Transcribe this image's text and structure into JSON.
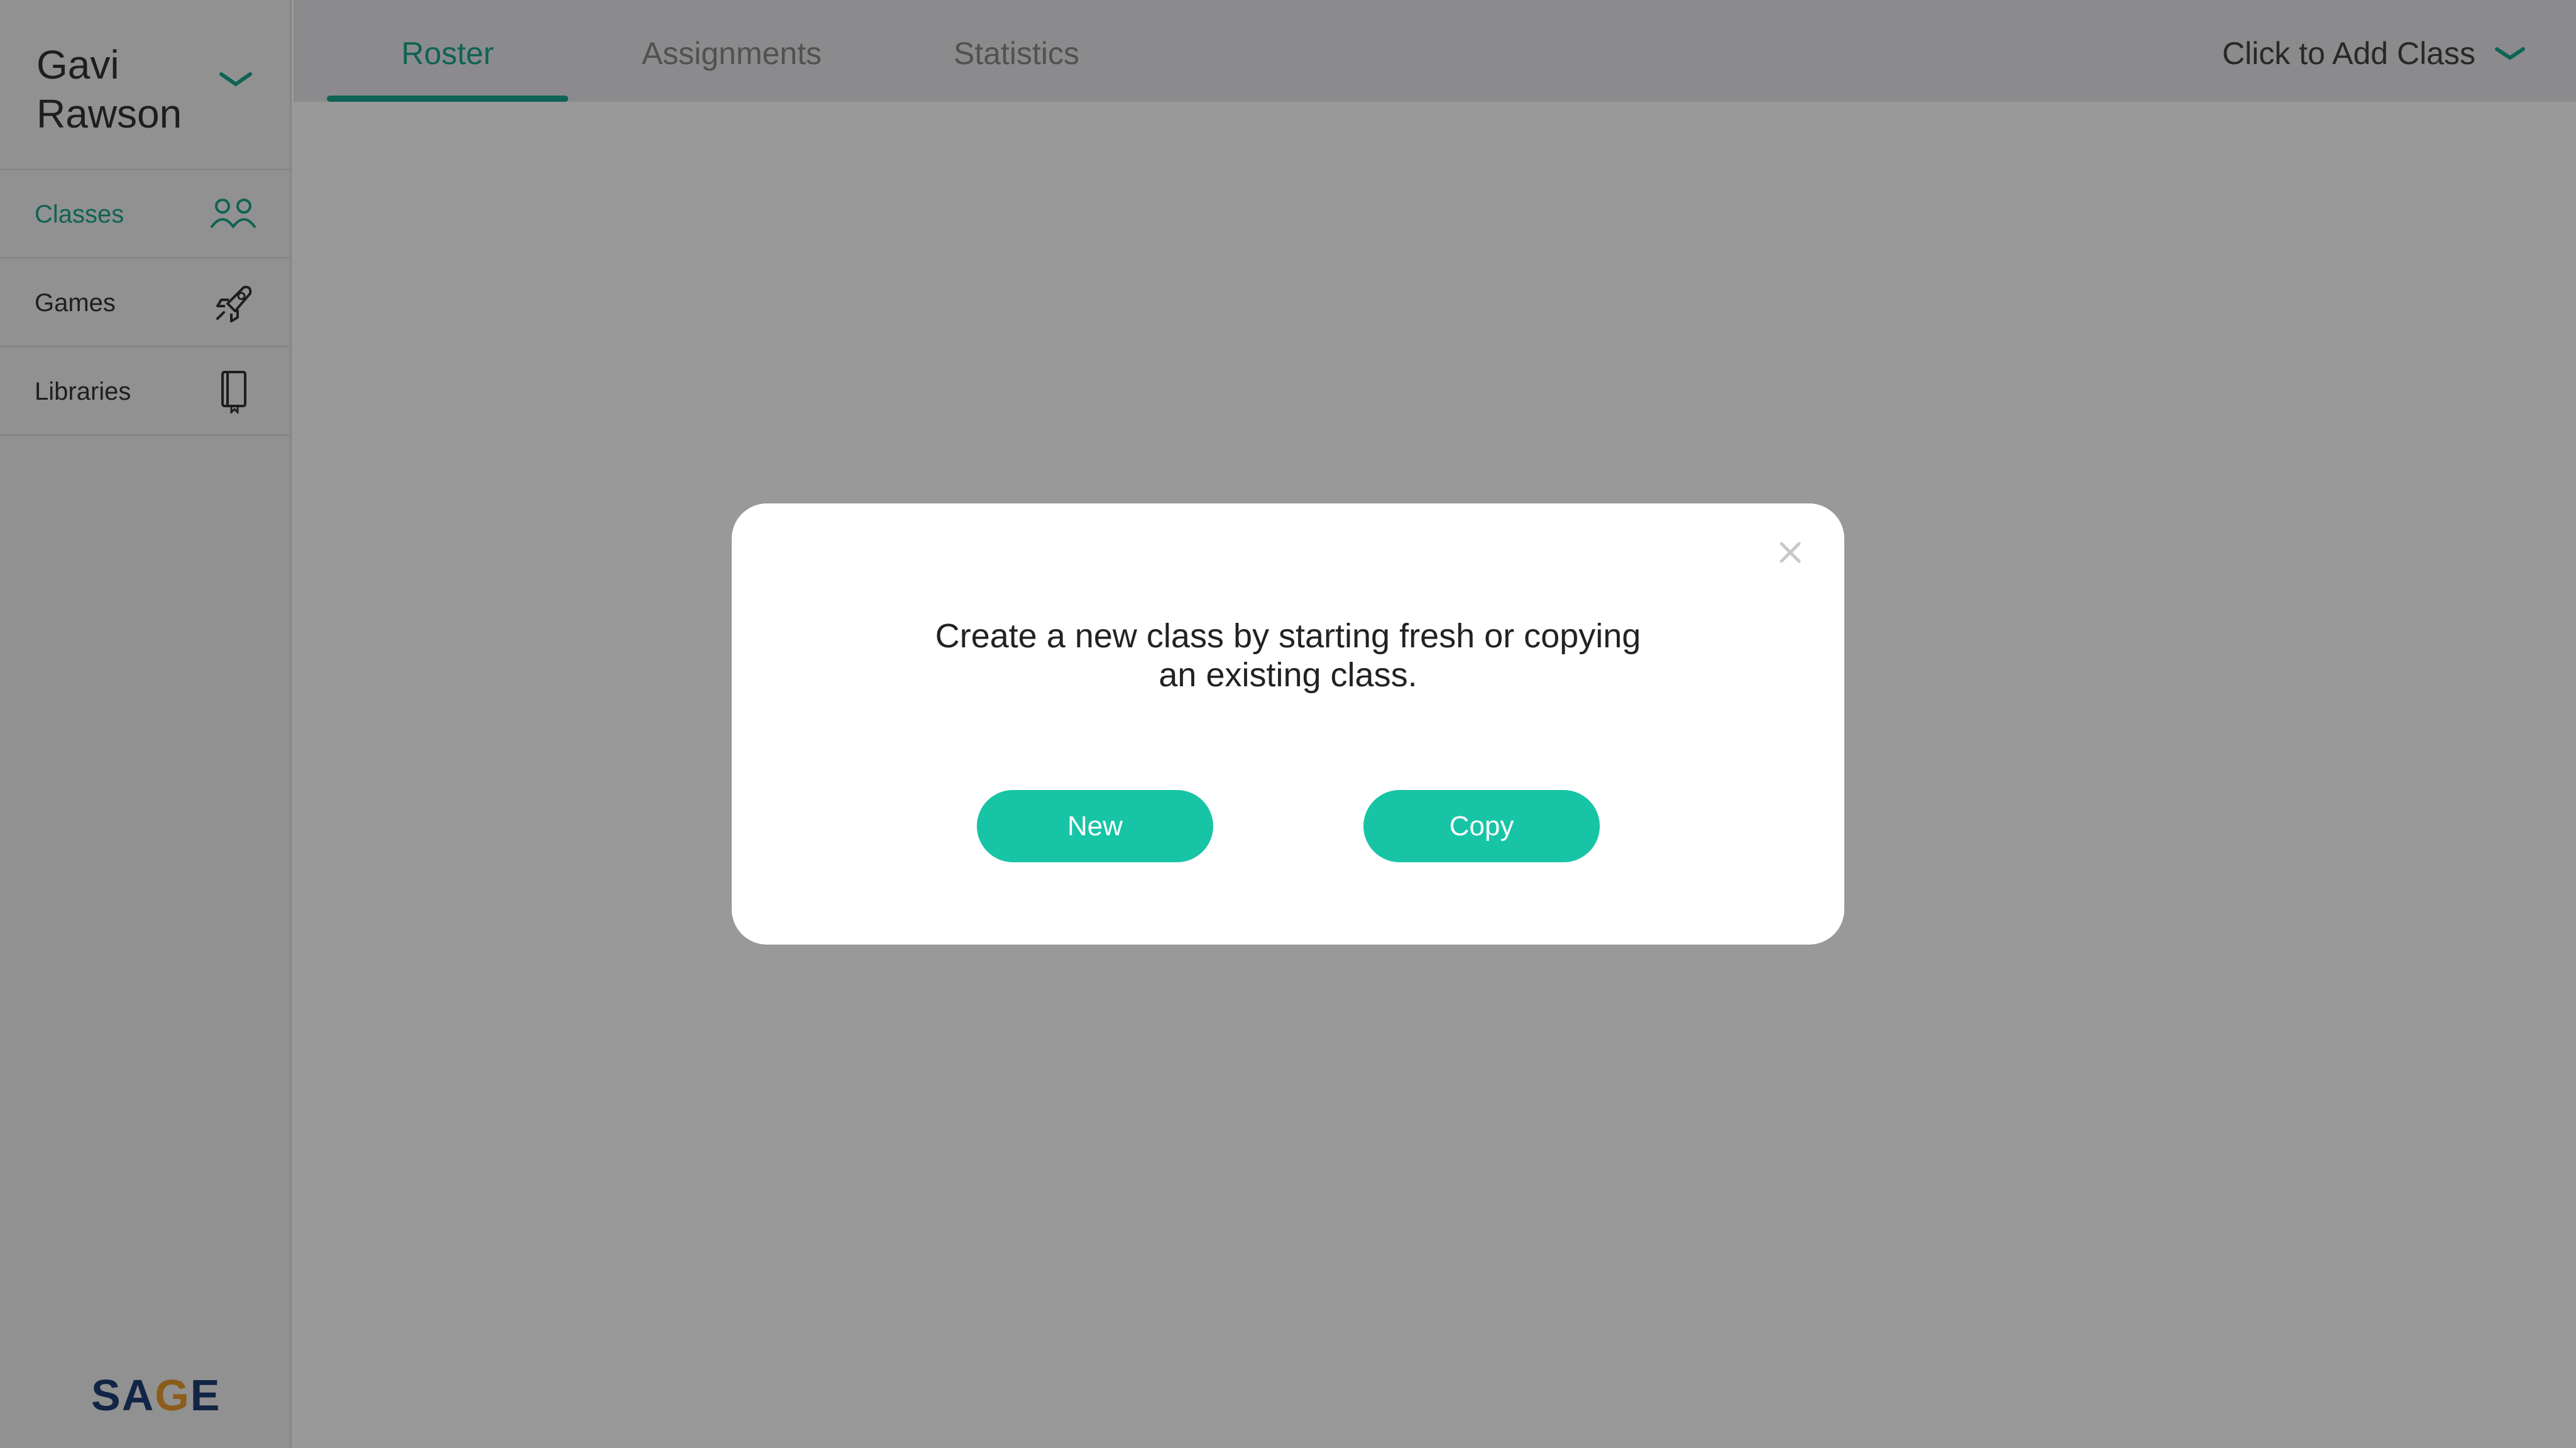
{
  "user": {
    "name": "Gavi Rawson"
  },
  "sidebar": {
    "items": [
      {
        "label": "Classes",
        "icon": "people-icon",
        "active": true
      },
      {
        "label": "Games",
        "icon": "rocket-icon",
        "active": false
      },
      {
        "label": "Libraries",
        "icon": "book-icon",
        "active": false
      }
    ]
  },
  "brand": {
    "logo_text_left": "SA",
    "logo_text_accent": "G",
    "logo_text_right": "E"
  },
  "tabs": [
    {
      "label": "Roster",
      "active": true
    },
    {
      "label": "Assignments",
      "active": false
    },
    {
      "label": "Statistics",
      "active": false
    }
  ],
  "class_selector": {
    "label": "Click to Add Class"
  },
  "modal": {
    "message": "Create a new class by starting fresh or copying an existing class.",
    "new_label": "New",
    "copy_label": "Copy"
  },
  "colors": {
    "accent": "#1aa58c",
    "button": "#18c4a6",
    "logo_blue": "#1f3f74",
    "logo_orange": "#e89a2c"
  }
}
